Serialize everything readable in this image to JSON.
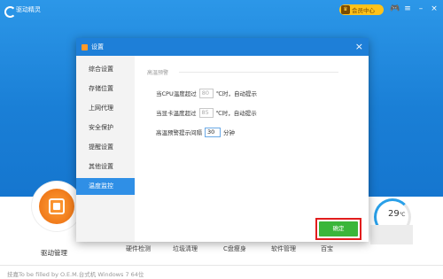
{
  "app": {
    "title": "驱动精灵",
    "vip_label": "会员中心",
    "top_icons": [
      "gamepad-icon",
      "menu-icon",
      "minimize-icon",
      "close-icon"
    ]
  },
  "dialog": {
    "title": "设置",
    "close_symbol": "×",
    "sidebar": [
      {
        "label": "综合设置",
        "active": false
      },
      {
        "label": "存储位置",
        "active": false
      },
      {
        "label": "上网代理",
        "active": false
      },
      {
        "label": "安全保护",
        "active": false
      },
      {
        "label": "提醒设置",
        "active": false
      },
      {
        "label": "其他设置",
        "active": false
      },
      {
        "label": "温度监控",
        "active": true
      }
    ],
    "section_title": "高温预警",
    "rows": {
      "cpu": {
        "label": "当CPU温度超过",
        "value": "80",
        "suffix": "℃时，自动提示"
      },
      "gpu": {
        "label": "当显卡温度超过",
        "value": "85",
        "suffix": "℃时，自动提示"
      },
      "interval": {
        "label": "高温预警提示间隔",
        "value": "30",
        "suffix": "分钟"
      }
    },
    "ok_label": "确定"
  },
  "main": {
    "driver_label": "驱动管理",
    "tabs": [
      "硬件检测",
      "垃圾清理",
      "C盘瘦身",
      "软件管理",
      "百宝"
    ],
    "temperature": "29",
    "temperature_unit": "℃"
  },
  "footer": {
    "text": "技嘉To be filled by O.E.M.台式机    Windows 7 64位"
  },
  "colors": {
    "header_blue": "#1e7fd8",
    "active_tab": "#2f8fe6",
    "ok_green": "#3ab63a",
    "highlight_red": "#e21d1d",
    "vip_gold": "#ffc21a"
  }
}
